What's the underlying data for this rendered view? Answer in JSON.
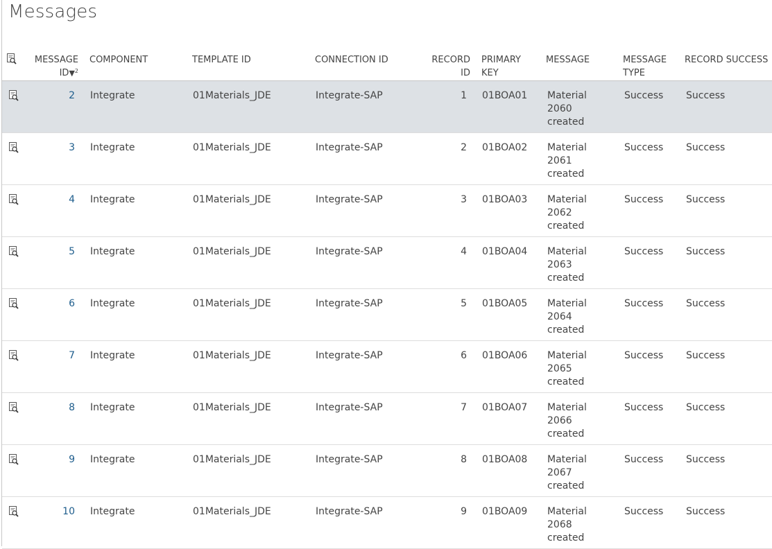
{
  "page": {
    "title": "Messages"
  },
  "table": {
    "columns": {
      "view": "",
      "message_id_1": "MESSAGE",
      "message_id_2": "ID",
      "sort_indicator": "▼",
      "sort_order": "2",
      "component": "COMPONENT",
      "template_id": "TEMPLATE ID",
      "connection_id": "CONNECTION ID",
      "record_id_1": "RECORD",
      "record_id_2": "ID",
      "primary_key_1": "PRIMARY",
      "primary_key_2": "KEY",
      "message": "MESSAGE",
      "message_type_1": "MESSAGE",
      "message_type_2": "TYPE",
      "record_success": "RECORD SUCCESS"
    },
    "rows": [
      {
        "message_id": "2",
        "component": "Integrate",
        "template_id": "01Materials_JDE",
        "connection_id": "Integrate-SAP",
        "record_id": "1",
        "primary_key": "01BOA01",
        "message": "Material 2060 created",
        "message_type": "Success",
        "record_success": "Success"
      },
      {
        "message_id": "3",
        "component": "Integrate",
        "template_id": "01Materials_JDE",
        "connection_id": "Integrate-SAP",
        "record_id": "2",
        "primary_key": "01BOA02",
        "message": "Material 2061 created",
        "message_type": "Success",
        "record_success": "Success"
      },
      {
        "message_id": "4",
        "component": "Integrate",
        "template_id": "01Materials_JDE",
        "connection_id": "Integrate-SAP",
        "record_id": "3",
        "primary_key": "01BOA03",
        "message": "Material 2062 created",
        "message_type": "Success",
        "record_success": "Success"
      },
      {
        "message_id": "5",
        "component": "Integrate",
        "template_id": "01Materials_JDE",
        "connection_id": "Integrate-SAP",
        "record_id": "4",
        "primary_key": "01BOA04",
        "message": "Material 2063 created",
        "message_type": "Success",
        "record_success": "Success"
      },
      {
        "message_id": "6",
        "component": "Integrate",
        "template_id": "01Materials_JDE",
        "connection_id": "Integrate-SAP",
        "record_id": "5",
        "primary_key": "01BOA05",
        "message": "Material 2064 created",
        "message_type": "Success",
        "record_success": "Success"
      },
      {
        "message_id": "7",
        "component": "Integrate",
        "template_id": "01Materials_JDE",
        "connection_id": "Integrate-SAP",
        "record_id": "6",
        "primary_key": "01BOA06",
        "message": "Material 2065 created",
        "message_type": "Success",
        "record_success": "Success"
      },
      {
        "message_id": "8",
        "component": "Integrate",
        "template_id": "01Materials_JDE",
        "connection_id": "Integrate-SAP",
        "record_id": "7",
        "primary_key": "01BOA07",
        "message": "Material 2066 created",
        "message_type": "Success",
        "record_success": "Success"
      },
      {
        "message_id": "9",
        "component": "Integrate",
        "template_id": "01Materials_JDE",
        "connection_id": "Integrate-SAP",
        "record_id": "8",
        "primary_key": "01BOA08",
        "message": "Material 2067 created",
        "message_type": "Success",
        "record_success": "Success"
      },
      {
        "message_id": "10",
        "component": "Integrate",
        "template_id": "01Materials_JDE",
        "connection_id": "Integrate-SAP",
        "record_id": "9",
        "primary_key": "01BOA09",
        "message": "Material 2068 created",
        "message_type": "Success",
        "record_success": "Success"
      }
    ],
    "selected_row": 0
  },
  "icons": {
    "view": "view-item-icon"
  },
  "colors": {
    "selected_row": "#dde1e5",
    "link": "#1e5d8c",
    "text": "#444444"
  }
}
